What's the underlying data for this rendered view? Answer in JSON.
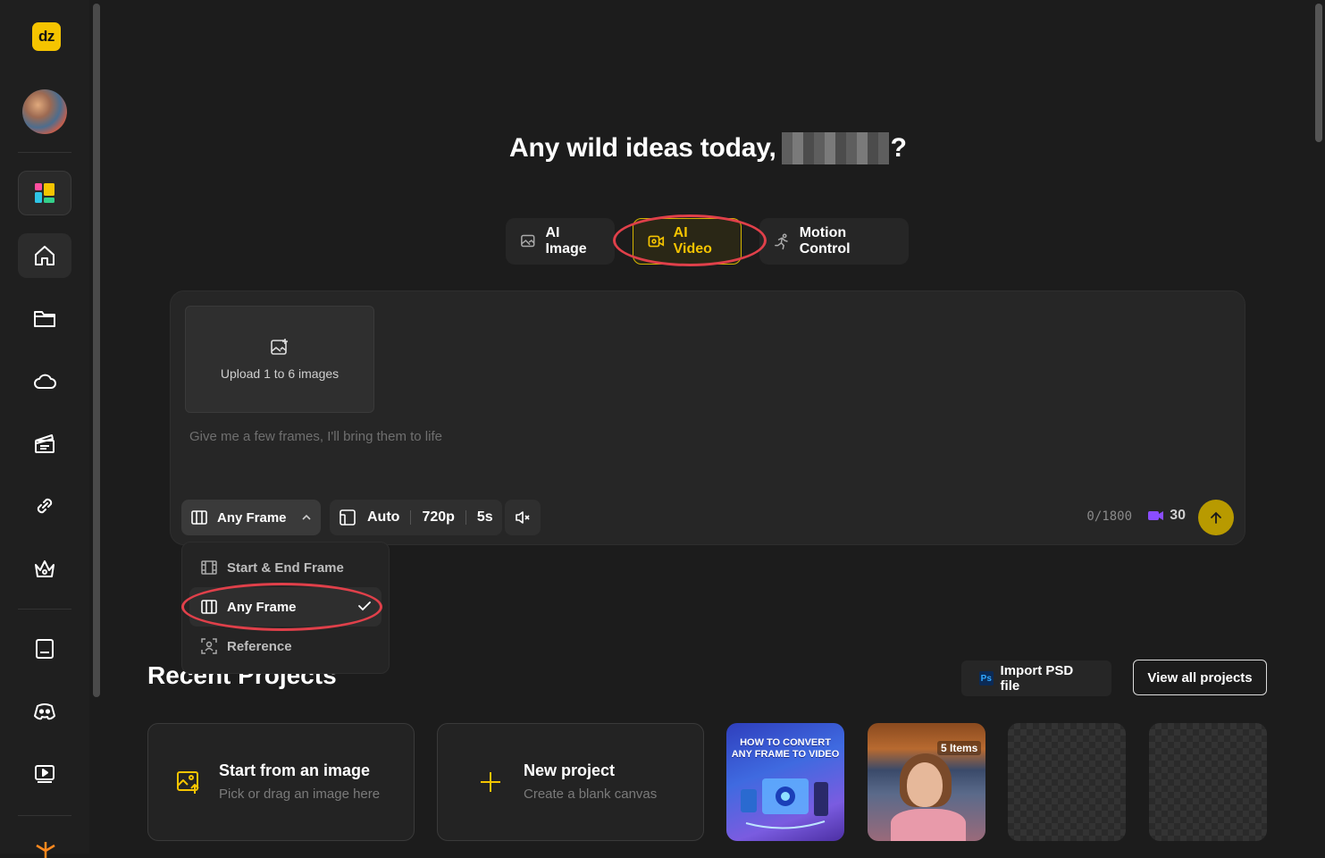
{
  "sidebar": {
    "logo_text": "dz",
    "items": [
      {
        "name": "apps",
        "icon": "apps-icon"
      },
      {
        "name": "home",
        "icon": "home-icon"
      },
      {
        "name": "folder",
        "icon": "folder-icon"
      },
      {
        "name": "cloud",
        "icon": "cloud-icon"
      },
      {
        "name": "templates",
        "icon": "clapperboard-icon"
      },
      {
        "name": "integrations",
        "icon": "link-icon"
      },
      {
        "name": "premium",
        "icon": "crown-icon"
      },
      {
        "name": "tutorials",
        "icon": "book-icon"
      },
      {
        "name": "discord",
        "icon": "discord-icon"
      },
      {
        "name": "video",
        "icon": "play-icon"
      }
    ]
  },
  "header": {
    "greeting": "Any wild ideas today,",
    "greeting_end": "?"
  },
  "modes": {
    "ai_image": "AI Image",
    "ai_video": "AI Video",
    "motion_control": "Motion Control",
    "selected": "AI Video"
  },
  "composer": {
    "upload_label": "Upload 1 to 6 images",
    "placeholder": "Give me a few frames, I'll bring them to life",
    "frame_mode": "Any Frame",
    "aspect": "Auto",
    "resolution": "720p",
    "duration": "5s",
    "char_count": "0/1800",
    "credits": "30"
  },
  "frame_dropdown": {
    "options": [
      "Start & End Frame",
      "Any Frame",
      "Reference"
    ],
    "selected": "Any Frame"
  },
  "recent": {
    "title": "Recent Projects",
    "import_psd": "Import PSD file",
    "view_all": "View all projects",
    "start_image_title": "Start from an image",
    "start_image_sub": "Pick or drag an image here",
    "new_project_title": "New project",
    "new_project_sub": "Create a blank canvas",
    "thumb1_text_line1": "HOW TO CONVERT",
    "thumb1_text_line2": "ANY FRAME TO VIDEO",
    "thumb2_badge": "5 Items"
  },
  "colors": {
    "accent": "#f5c400",
    "highlight_oval": "#e0404a",
    "background": "#1c1c1c"
  }
}
